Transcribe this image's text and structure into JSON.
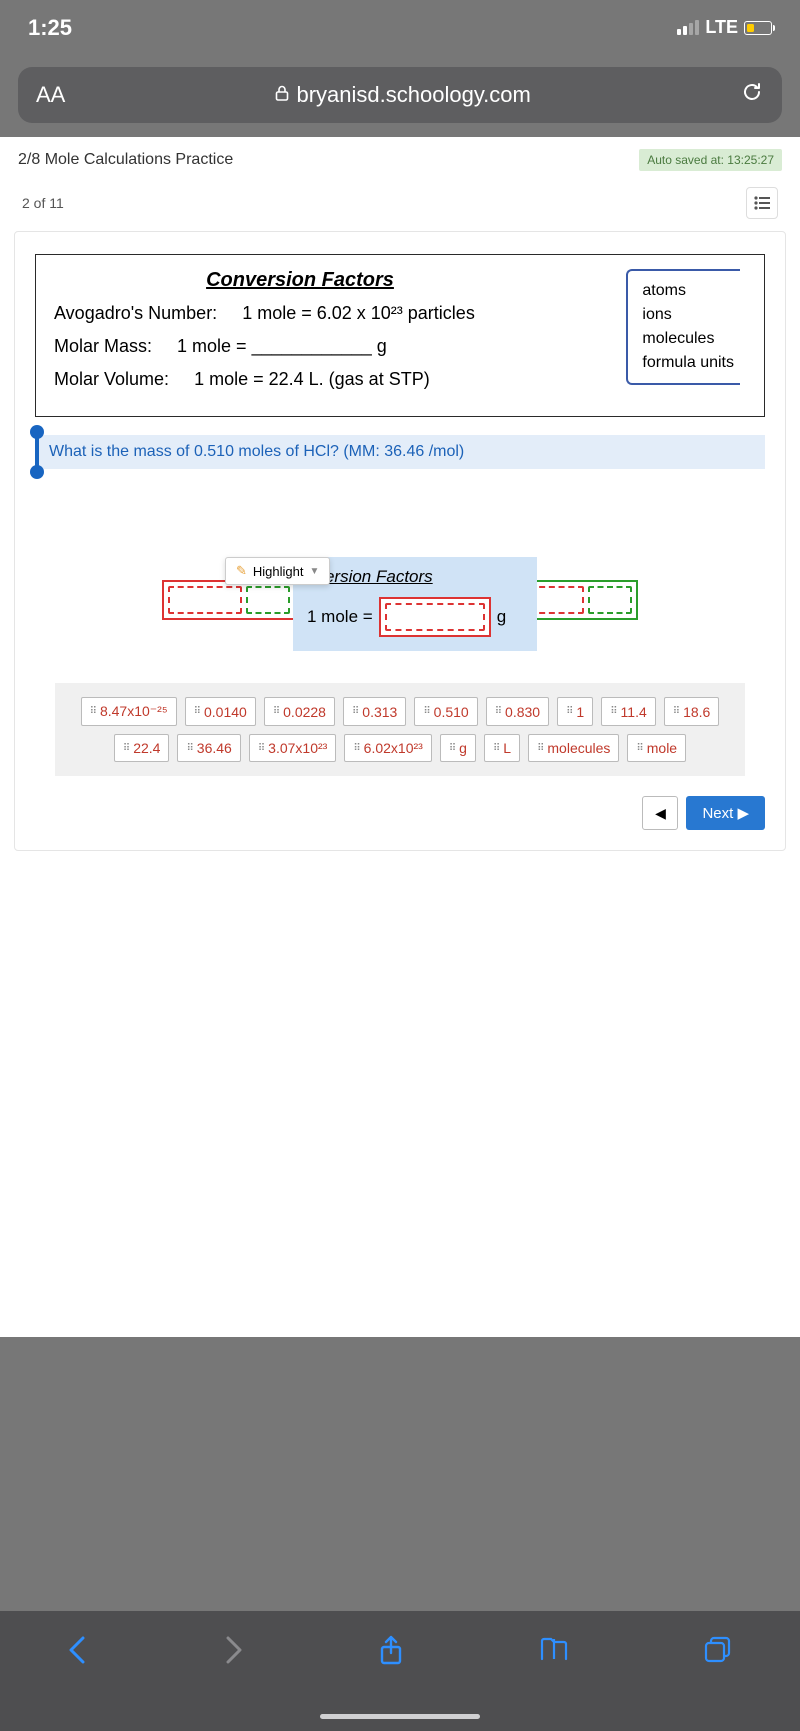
{
  "status": {
    "time": "1:25",
    "network": "LTE"
  },
  "browser": {
    "aa": "AA",
    "url": "bryanisd.schoology.com"
  },
  "header": {
    "title": "2/8 Mole Calculations Practice",
    "autosave": "Auto saved at: 13:25:27",
    "progress": "2 of 11"
  },
  "reference": {
    "title": "Conversion Factors",
    "avogadro_label": "Avogadro's Number:",
    "avogadro_value": "1 mole = 6.02 x 10²³ particles",
    "molarmass_label": "Molar Mass:",
    "molarmass_value": "1 mole = ____________ g",
    "molarvol_label": "Molar Volume:",
    "molarvol_value": "1 mole = 22.4 L.  (gas at STP)",
    "side": {
      "a": "atoms",
      "b": "ions",
      "c": "molecules",
      "d": "formula units"
    }
  },
  "question": "What is the mass of 0.510 moles of HCl?  (MM: 36.46 /mol)",
  "highlight": {
    "label": "Highlight"
  },
  "cf_panel": {
    "title": "nversion Factors",
    "row": "1 mole =",
    "g": "g"
  },
  "equation": {
    "mult": "✕",
    "eq": "="
  },
  "bank": {
    "c1": "8.47x10⁻²⁵",
    "c2": "0.0140",
    "c3": "0.0228",
    "c4": "0.313",
    "c5": "0.510",
    "c6": "0.830",
    "c7": "1",
    "c8": "11.4",
    "c9": "18.6",
    "c10": "22.4",
    "c11": "36.46",
    "c12": "3.07x10²³",
    "c13": "6.02x10²³",
    "c14": "g",
    "c15": "L",
    "c16": "molecules",
    "c17": "mole"
  },
  "nav": {
    "prev": "◀",
    "next": "Next ▶"
  }
}
